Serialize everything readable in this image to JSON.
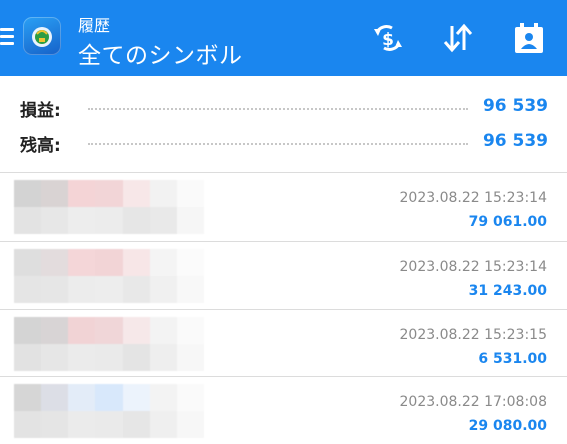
{
  "header": {
    "title": "履歴",
    "subtitle": "全てのシンボル",
    "colors": {
      "bar": "#1a86ef",
      "text": "#ffffff"
    },
    "actions": [
      {
        "name": "currency-filter-button",
        "icon": "dollar-arrows-icon"
      },
      {
        "name": "sort-button",
        "icon": "sort-arrows-icon"
      },
      {
        "name": "calendar-button",
        "icon": "calendar-person-icon"
      }
    ]
  },
  "summary": {
    "profit_label": "損益:",
    "profit_value": "96 539",
    "balance_label": "残高:",
    "balance_value": "96 539"
  },
  "deals": [
    {
      "time": "2023.08.22 15:23:14",
      "amount": "79 061.00"
    },
    {
      "time": "2023.08.22 15:23:14",
      "amount": "31 243.00"
    },
    {
      "time": "2023.08.22 15:23:15",
      "amount": "6 531.00"
    },
    {
      "time": "2023.08.22 17:08:08",
      "amount": "29 080.00"
    }
  ],
  "colors": {
    "accent": "#1a86ef",
    "muted": "#8a8a8a"
  }
}
